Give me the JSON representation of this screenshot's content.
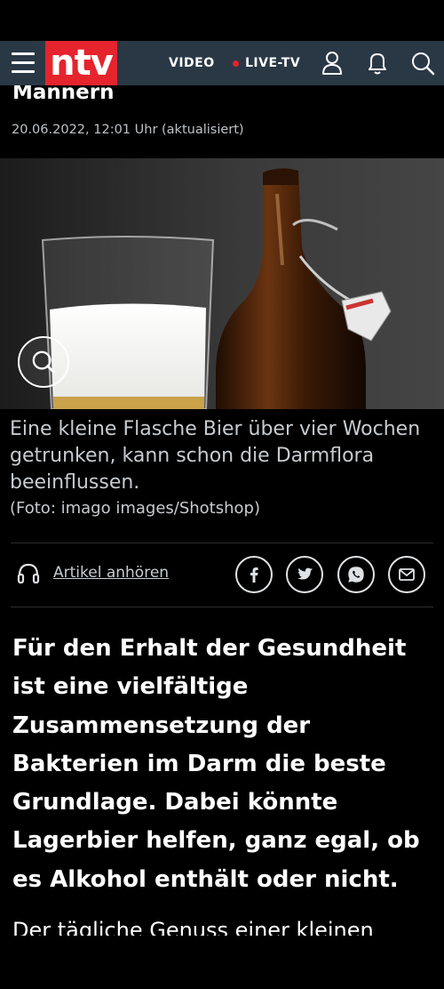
{
  "nav": {
    "brand": "ntv",
    "video_label": "VIDEO",
    "live_label": "LIVE-TV",
    "icons": [
      "menu-icon",
      "user-icon",
      "bell-icon",
      "search-icon"
    ]
  },
  "article": {
    "headline_tail": "Männern",
    "date": "20.06.2022, 12:01 Uhr (aktualisiert)",
    "caption": "Eine kleine Flasche Bier über vier Wochen getrunken, kann schon die Darmflora beeinflussen.",
    "credit": "(Foto: imago images/Shotshop)",
    "listen_label": "Artikel anhören",
    "share_icons": [
      "facebook-icon",
      "twitter-icon",
      "whatsapp-icon",
      "email-icon"
    ],
    "lead": "Für den Erhalt der Gesundheit ist eine vielfältige Zusammensetzung der Bakterien im Darm die beste Grundlage. Dabei könnte Lagerbier helfen, ganz egal, ob es Alkohol enthält oder nicht.",
    "body_start": "Der tägliche Genuss einer kleinen"
  },
  "colors": {
    "brand_red": "#e5242d",
    "nav_bg": "#2a3846"
  }
}
